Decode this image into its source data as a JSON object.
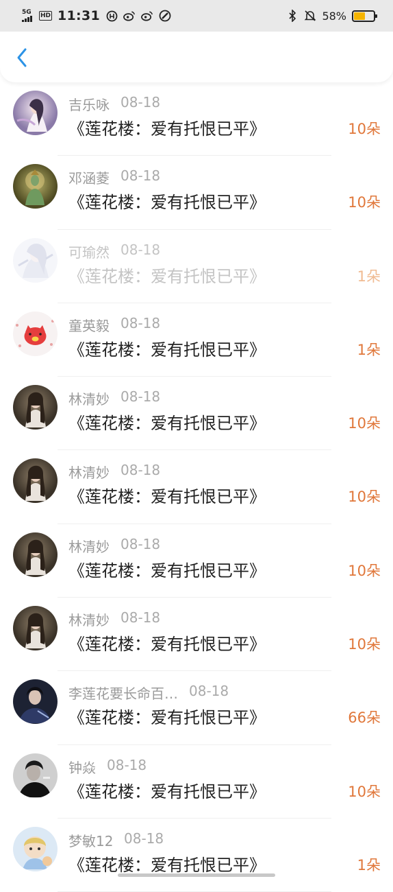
{
  "status_bar": {
    "network": "5G",
    "hd": "HD",
    "time": "11:31",
    "battery_percent": "58%",
    "battery_level": 0.58,
    "battery_color": "#f5b400",
    "icons": [
      "signal-icon",
      "hd-icon",
      "app-notification-icon",
      "weibo-icon",
      "weibo-icon",
      "link-icon",
      "bluetooth-icon",
      "mute-icon",
      "battery-icon"
    ]
  },
  "header": {
    "back_icon": "chevron-left-icon",
    "accent_color": "#2c93e6"
  },
  "accent_amount_color": "#e0773a",
  "gifts": [
    {
      "name": "吉乐咏",
      "date": "08-18",
      "title": "《莲花楼：爱有托恨已平》",
      "amount": "10朵",
      "faded": false
    },
    {
      "name": "邓涵菱",
      "date": "08-18",
      "title": "《莲花楼：爱有托恨已平》",
      "amount": "10朵",
      "faded": false
    },
    {
      "name": "可瑜然",
      "date": "08-18",
      "title": "《莲花楼：爱有托恨已平》",
      "amount": "1朵",
      "faded": true
    },
    {
      "name": "童英毅",
      "date": "08-18",
      "title": "《莲花楼：爱有托恨已平》",
      "amount": "1朵",
      "faded": false
    },
    {
      "name": "林清妙",
      "date": "08-18",
      "title": "《莲花楼：爱有托恨已平》",
      "amount": "10朵",
      "faded": false
    },
    {
      "name": "林清妙",
      "date": "08-18",
      "title": "《莲花楼：爱有托恨已平》",
      "amount": "10朵",
      "faded": false
    },
    {
      "name": "林清妙",
      "date": "08-18",
      "title": "《莲花楼：爱有托恨已平》",
      "amount": "10朵",
      "faded": false
    },
    {
      "name": "林清妙",
      "date": "08-18",
      "title": "《莲花楼：爱有托恨已平》",
      "amount": "10朵",
      "faded": false
    },
    {
      "name": "李莲花要长命百…",
      "date": "08-18",
      "title": "《莲花楼：爱有托恨已平》",
      "amount": "66朵",
      "faded": false
    },
    {
      "name": "钟焱",
      "date": "08-18",
      "title": "《莲花楼：爱有托恨已平》",
      "amount": "10朵",
      "faded": false
    },
    {
      "name": "梦敏12",
      "date": "08-18",
      "title": "《莲花楼：爱有托恨已平》",
      "amount": "1朵",
      "faded": false
    }
  ]
}
